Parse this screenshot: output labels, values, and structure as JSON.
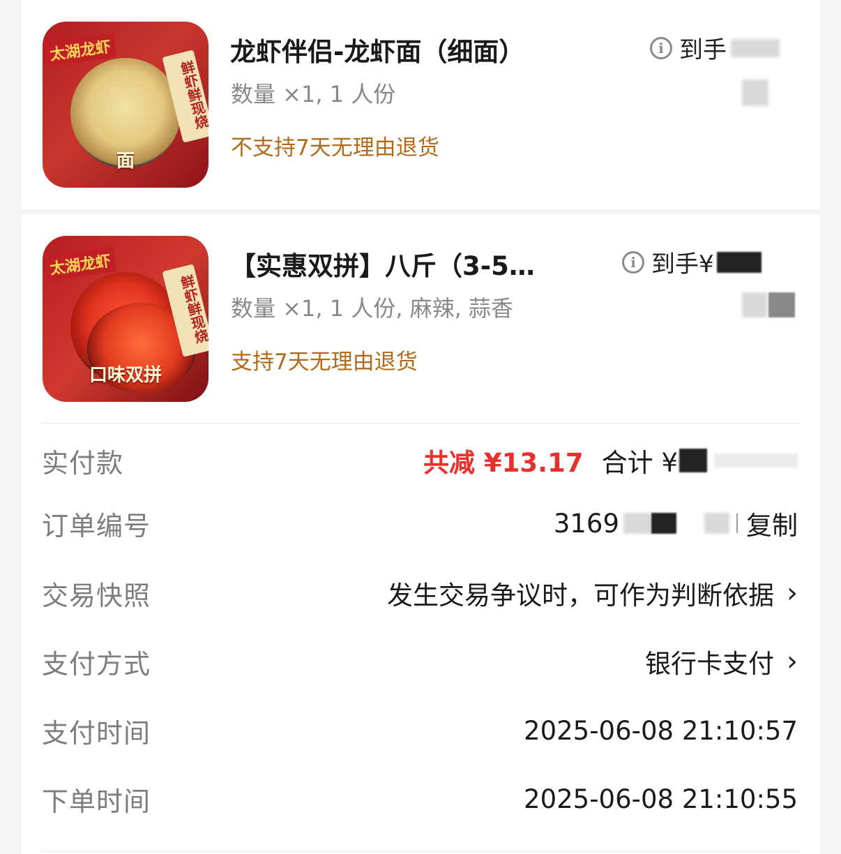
{
  "products": [
    {
      "title": "龙虾伴侣-龙虾面（细面）",
      "spec": "数量 ×1, 1 人份",
      "policy": "不支持7天无理由退货",
      "price_label": "到手",
      "image": {
        "tag": "太湖龙虾",
        "banner": "鲜虾鲜现烧",
        "caption": "面"
      }
    },
    {
      "title": "【实惠双拼】八斤（3-5…",
      "spec": "数量 ×1, 1 人份, 麻辣, 蒜香",
      "policy": "支持7天无理由退货",
      "price_label": "到手¥",
      "image": {
        "tag": "太湖龙虾",
        "banner": "鲜虾鲜现烧",
        "caption": "口味双拼"
      }
    }
  ],
  "summary": {
    "paid": {
      "label": "实付款",
      "reduction": "共减 ¥13.17",
      "total_label": "合计 ¥"
    },
    "order_no": {
      "label": "订单编号",
      "value_prefix": "3169",
      "copy": "复制"
    },
    "snapshot": {
      "label": "交易快照",
      "value": "发生交易争议时，可作为判断依据"
    },
    "payment_method": {
      "label": "支付方式",
      "value": "银行卡支付"
    },
    "pay_time": {
      "label": "支付时间",
      "value": "2025-06-08 21:10:57"
    },
    "order_time": {
      "label": "下单时间",
      "value": "2025-06-08 21:10:55"
    }
  },
  "icons": {
    "info": "info-circle-icon",
    "chevron": "chevron-right-icon"
  },
  "colors": {
    "reduction": "#e8302c",
    "policy": "#b36a18",
    "label": "#7d7d7d"
  }
}
